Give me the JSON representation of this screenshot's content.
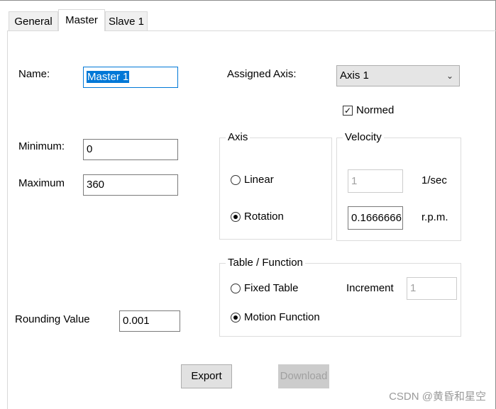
{
  "tabs": [
    {
      "label": "General"
    },
    {
      "label": "Master"
    },
    {
      "label": "Slave 1"
    }
  ],
  "left": {
    "name_label": "Name:",
    "name_value": "Master 1",
    "minimum_label": "Minimum:",
    "minimum_value": "0",
    "maximum_label": "Maximum",
    "maximum_value": "360",
    "rounding_label": "Rounding Value",
    "rounding_value": "0.001"
  },
  "assigned": {
    "label": "Assigned Axis:",
    "value": "Axis 1"
  },
  "normed": {
    "label": "Normed",
    "checked": true
  },
  "axis_group": {
    "title": "Axis",
    "linear": "Linear",
    "rotation": "Rotation",
    "selected": "rotation"
  },
  "velocity_group": {
    "title": "Velocity",
    "sec_value": "1",
    "sec_unit": "1/sec",
    "rpm_value": "0.1666666",
    "rpm_unit": "r.p.m."
  },
  "table_group": {
    "title": "Table / Function",
    "fixed": "Fixed Table",
    "motion": "Motion Function",
    "selected": "motion",
    "increment_label": "Increment",
    "increment_value": "1"
  },
  "buttons": {
    "export": "Export",
    "download": "Download"
  },
  "watermark": "CSDN @黄昏和星空"
}
